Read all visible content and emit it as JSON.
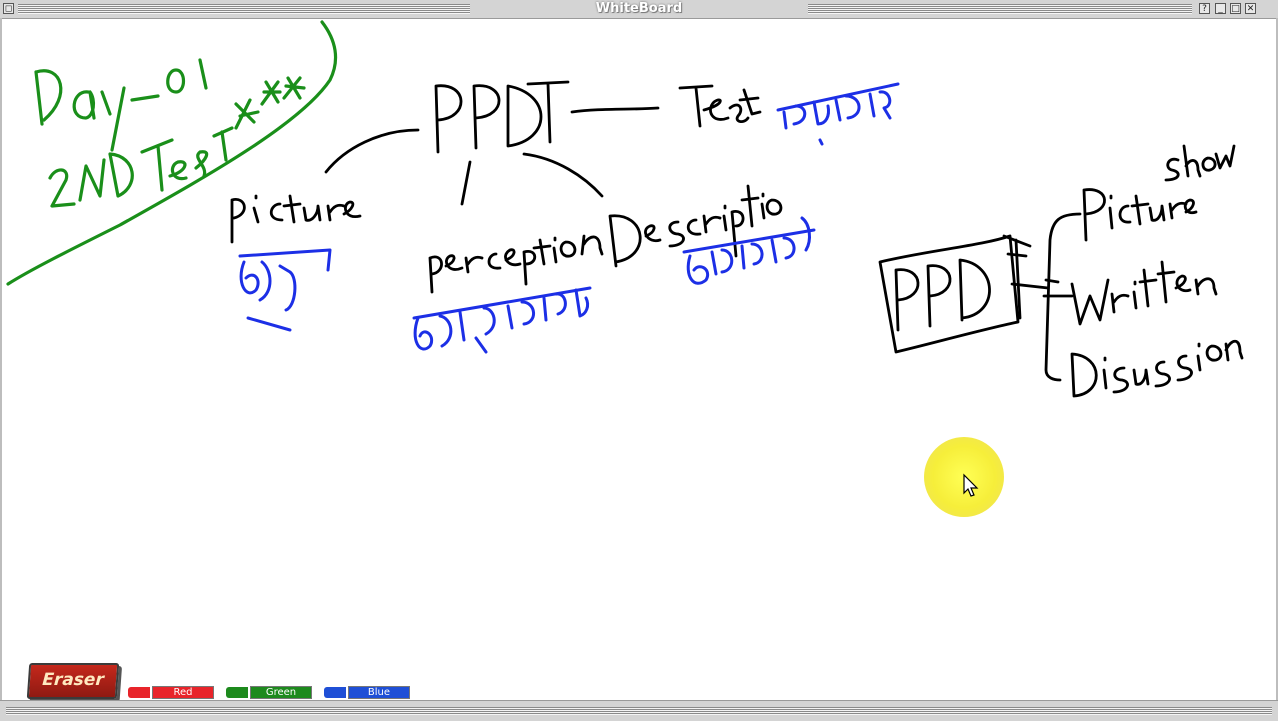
{
  "window": {
    "title": "WhiteBoard",
    "buttons": [
      "?",
      "_",
      "□",
      "✕"
    ]
  },
  "board": {
    "notes_green": [
      "Day-01",
      "2ND Test**"
    ],
    "center_heading": "PPDT",
    "test_label": "Test",
    "test_bengali": "পরীক্ষা",
    "branches": [
      {
        "label": "picture",
        "bengali": "ছবি"
      },
      {
        "label": "perception",
        "bengali": "অনুমানকরণ"
      },
      {
        "label": "Description",
        "bengali": "বর্ণনাকরণ"
      }
    ],
    "right_box": "PPDT",
    "right_list": [
      "Picture",
      "Written",
      "Discussion"
    ],
    "right_note": "Show"
  },
  "toolbar": {
    "eraser_label": "Eraser",
    "markers": [
      {
        "label": "Red",
        "color": "#e8242a"
      },
      {
        "label": "Green",
        "color": "#1d8a1d"
      },
      {
        "label": "Blue",
        "color": "#1f4fd6"
      }
    ]
  },
  "colors": {
    "ink_black": "#000000",
    "ink_green": "#1a8f1a",
    "ink_blue": "#1c2fe6",
    "pointer_highlight": "#f7f03a"
  }
}
